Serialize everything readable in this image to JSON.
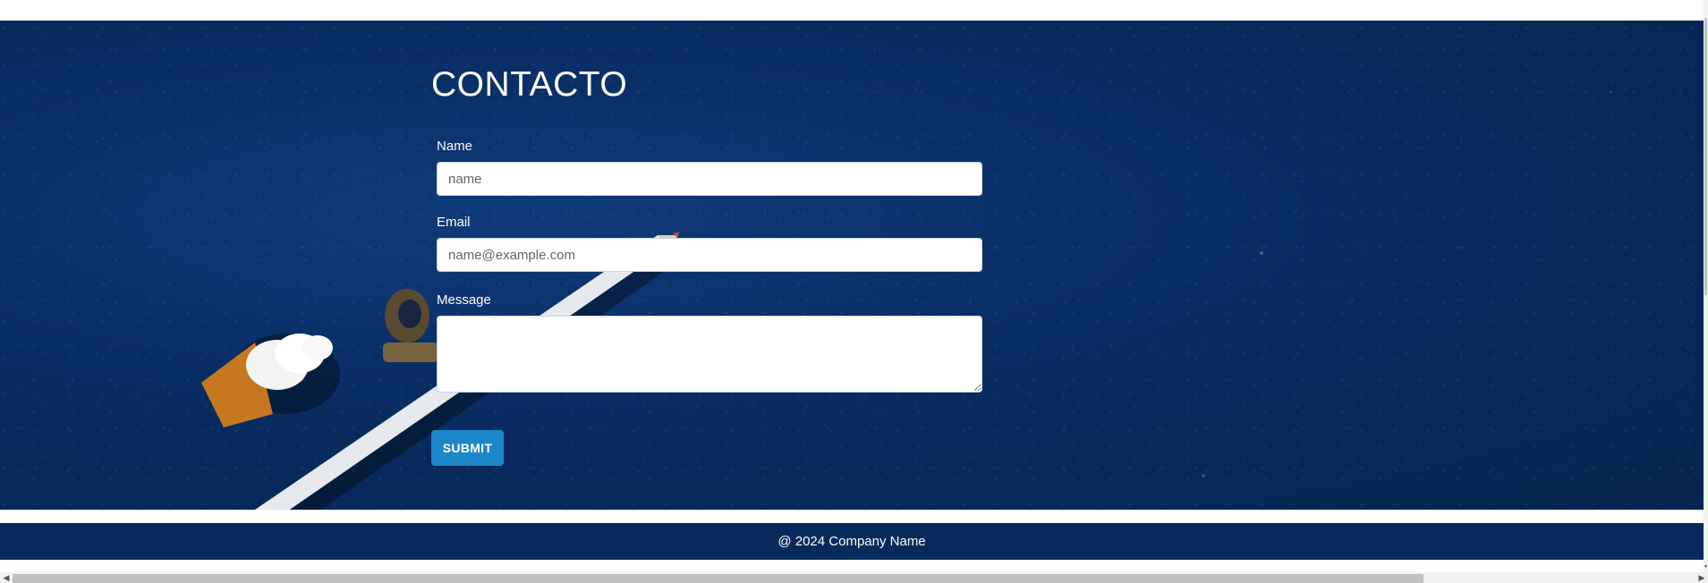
{
  "contact": {
    "title": "CONTACTO",
    "name_label": "Name",
    "name_placeholder": "name",
    "email_label": "Email",
    "email_placeholder": "name@example.com",
    "message_label": "Message",
    "submit_label": "SUBMIT"
  },
  "footer": {
    "text": "@ 2024 Company Name"
  },
  "colors": {
    "hero_background": "#072a5c",
    "footer_background": "#062a5c",
    "submit_button": "#1b87c9"
  },
  "icons": {
    "scroll_left": "chevron-left-icon",
    "scroll_right": "chevron-right-icon",
    "scroll_down": "chevron-down-icon"
  }
}
